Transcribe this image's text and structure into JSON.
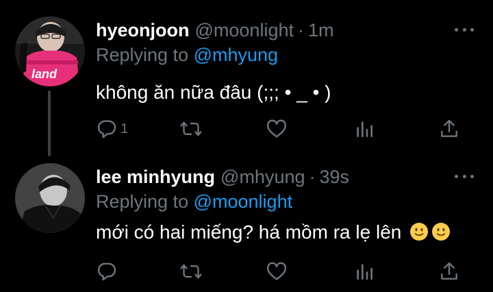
{
  "tweets": [
    {
      "name": "hyeonjoon",
      "handle": "@moonlight",
      "separator": "·",
      "time": "1m",
      "replying_prefix": "Replying to",
      "replying_to": "@mhyung",
      "text": "không ăn nữa đâu (;;; • _ • )",
      "avatar_jersey_text": "land",
      "actions": {
        "reply_count": "1",
        "retweet_count": "",
        "like_count": ""
      }
    },
    {
      "name": "lee minhyung",
      "handle": "@mhyung",
      "separator": "·",
      "time": "39s",
      "replying_prefix": "Replying to",
      "replying_to": "@moonlight",
      "text": "mới có hai miếng? há mồm ra lẹ lên",
      "emojis": [
        "slightly-smiling-face",
        "slightly-smiling-face"
      ],
      "actions": {
        "reply_count": "",
        "retweet_count": "",
        "like_count": ""
      }
    }
  ],
  "colors": {
    "background": "#000000",
    "primary_text": "#ffffff",
    "secondary_text": "#6e767d",
    "mention": "#1d9bf0",
    "thread_line": "#3b3f44"
  }
}
